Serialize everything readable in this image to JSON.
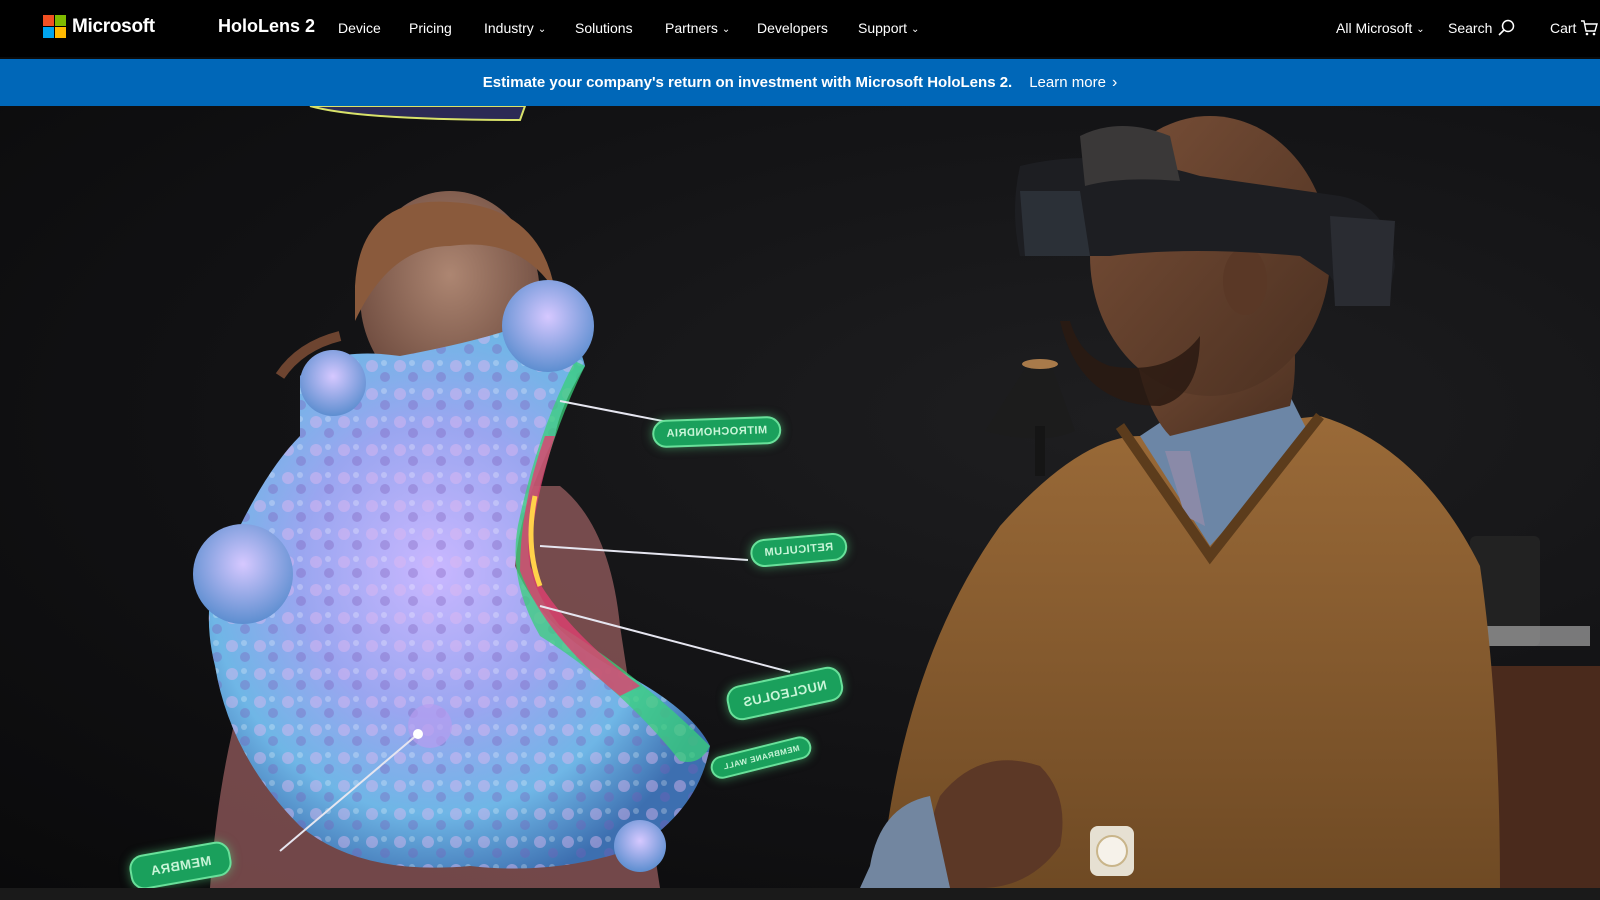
{
  "nav": {
    "brand": "Microsoft",
    "product": "HoloLens 2",
    "items": [
      {
        "label": "Device"
      },
      {
        "label": "Pricing"
      },
      {
        "label": "Industry",
        "dropdown": true
      },
      {
        "label": "Solutions"
      },
      {
        "label": "Partners",
        "dropdown": true
      },
      {
        "label": "Developers"
      },
      {
        "label": "Support",
        "dropdown": true
      }
    ],
    "all_microsoft": "All Microsoft",
    "search": "Search",
    "cart": "Cart"
  },
  "banner": {
    "message": "Estimate your company's return on investment with Microsoft HoloLens 2.",
    "link": "Learn more"
  },
  "hero": {
    "labels": [
      "MITROCHONDRIA",
      "RETICULUM",
      "NUCLEOLUS",
      "MEMBRANE WALL",
      "MEMBRA"
    ]
  },
  "colors": {
    "nav_bg": "#000000",
    "banner_bg": "#0067b8",
    "logo_red": "#f25022",
    "logo_green": "#7fba00",
    "logo_blue": "#00a4ef",
    "logo_yellow": "#ffb900"
  }
}
